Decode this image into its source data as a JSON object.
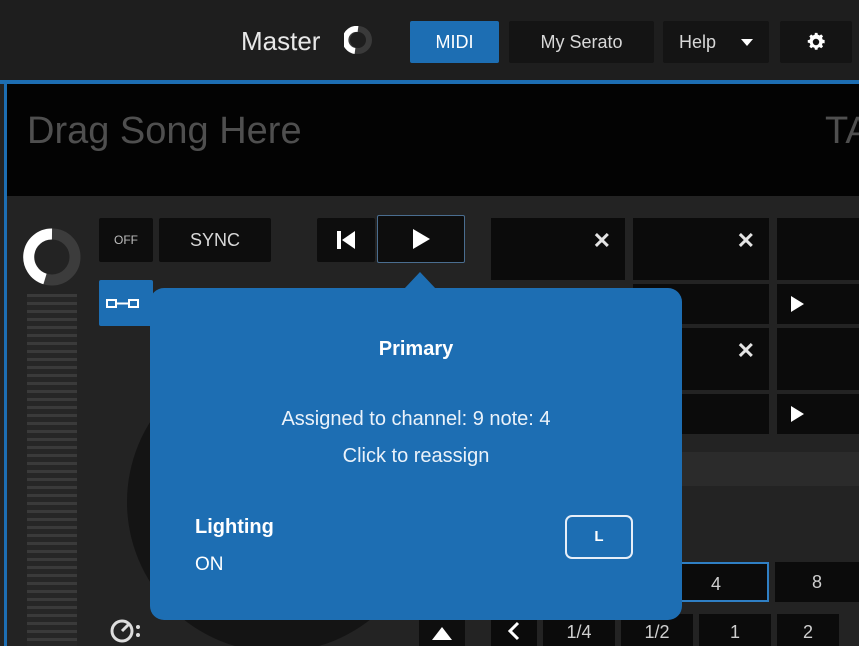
{
  "topbar": {
    "master_label": "Master",
    "midi_label": "MIDI",
    "my_serato_label": "My Serato",
    "help_label": "Help"
  },
  "deck": {
    "drag_song_text": "Drag Song Here",
    "partial_title_text": "TA",
    "off_label": "OFF",
    "sync_label": "SYNC"
  },
  "pads": {
    "lower_row": [
      "1/4",
      "1/2",
      "1",
      "2"
    ],
    "value_boxes": [
      "4",
      "8"
    ]
  },
  "popup": {
    "title": "Primary",
    "assigned_text": "Assigned to channel: 9 note: 4",
    "reassign_text": "Click to reassign",
    "lighting_label": "Lighting",
    "lighting_value": "ON",
    "key_label": "L"
  },
  "colors": {
    "accent": "#1d6eb3",
    "background": "#242424",
    "song_box": "#030303"
  },
  "icons": [
    "master-knob-icon",
    "caret-down-icon",
    "gear-icon",
    "deck-knob-icon",
    "skip-back-icon",
    "play-icon",
    "link-icon",
    "close-icon",
    "pitch-icon",
    "arrow-up-icon",
    "chevron-left-icon"
  ]
}
